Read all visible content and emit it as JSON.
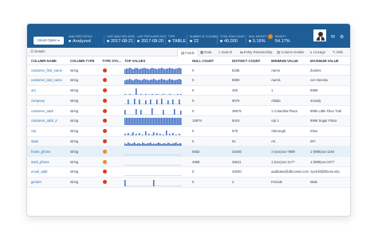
{
  "header": {
    "smart_option": "Smart Option ▾",
    "analyzed_status": {
      "label": "ANALYZED STATUS",
      "value": "Analyzed"
    },
    "last_analyzed_date": {
      "label": "LAST ANALYZED DATE",
      "value": "2017-08-21"
    },
    "last_populated_date": {
      "label": "LAST POPULATED DATE",
      "value": "2017-08-20"
    },
    "type": {
      "label": "TYPE",
      "value": "TABLE"
    },
    "number_of_columns": {
      "label": "NUMBER OF COLUMNS",
      "value": "22"
    },
    "total_row_count": {
      "label": "TOTAL ROW COUNT",
      "value": "40,000"
    },
    "null_density": {
      "label": "NULL DENSITY",
      "value": "5.16%"
    },
    "density": {
      "label": "DENSITY",
      "value": "54.17%"
    }
  },
  "tabs": {
    "details": "Details",
    "items": [
      "Fields",
      "Data",
      "Search",
      "Entity Relationship",
      "Column Details",
      "Lineage",
      "Wiki"
    ],
    "active": "Fields"
  },
  "columns": [
    "COLUMN NAME",
    "COLUMN TYPE",
    "TYPE STA...",
    "TOP VALUES",
    "NULL COUNT",
    "DISTINCT COUNT",
    "MINIMUM VALUE",
    "MAXIMUM VALUE"
  ],
  "rows": [
    {
      "name": "customer_first_name",
      "type": "string",
      "status": "#e03a1a",
      "null": "0",
      "distinct": "8335",
      "min": "Aaron",
      "max": "Zuisms",
      "spark": [
        6,
        7,
        7,
        8,
        7,
        6,
        7,
        8,
        7,
        6,
        7,
        7,
        8,
        7,
        7,
        6,
        7,
        8,
        7,
        7,
        6,
        7,
        7,
        8,
        7,
        6,
        7,
        7,
        8,
        7,
        7,
        6,
        7,
        7,
        8,
        7
      ]
    },
    {
      "name": "customer_last_name",
      "type": "string",
      "status": "#e03a1a",
      "null": "0",
      "distinct": "8809",
      "min": "Aamis",
      "max": "von Neesku",
      "spark": [
        5,
        6,
        6,
        7,
        6,
        5,
        6,
        7,
        6,
        6,
        5,
        6,
        7,
        6,
        6,
        5,
        6,
        6,
        7,
        6,
        5,
        6,
        6,
        7,
        6,
        6,
        5,
        6,
        7,
        6,
        6,
        5,
        6,
        6,
        7,
        6
      ]
    },
    {
      "name": "am",
      "type": "string",
      "status": "#e03a1a",
      "null": "0",
      "distinct": "400",
      "min": "1",
      "max": "9999",
      "spark": [
        1,
        0,
        0,
        1,
        0,
        0,
        0,
        8,
        0,
        0,
        1,
        0,
        0,
        1,
        0,
        0,
        0,
        1,
        0,
        0,
        1,
        0,
        0,
        0,
        1,
        0,
        0,
        0,
        1,
        0,
        0,
        0,
        0,
        1,
        0,
        1
      ]
    },
    {
      "name": "company",
      "type": "string",
      "status": "#e03a1a",
      "null": "0",
      "distinct": "9075",
      "min": "Abidia",
      "max": "Zooaily",
      "spark": [
        0,
        0,
        6,
        0,
        0,
        0,
        7,
        0,
        0,
        6,
        0,
        0,
        0,
        5,
        0,
        0,
        6,
        0,
        0,
        0,
        6,
        0,
        0,
        7,
        0,
        0,
        0,
        5,
        0,
        0,
        6,
        0,
        0,
        0,
        6,
        0
      ]
    },
    {
      "name": "customer_addr",
      "type": "string",
      "status": "#e03a1a",
      "null": "0",
      "distinct": "39575",
      "min": "1 Columbia Plaza",
      "max": "9995 Little Fleur Trail",
      "spark": [
        6,
        0,
        0,
        0,
        0,
        0,
        0,
        7,
        0,
        0,
        6,
        0,
        0,
        0,
        0,
        0,
        0,
        8,
        0,
        0,
        0,
        0,
        0,
        0,
        6,
        0,
        0,
        0,
        0,
        0,
        0,
        7,
        0,
        0,
        0,
        5
      ]
    },
    {
      "name": "customer_addr_2",
      "type": "string",
      "status": "#e03a1a",
      "null": "19579",
      "distinct": "9419",
      "min": "Apt 1",
      "max": "9998 Sugar Plaza",
      "spark": [
        9,
        9,
        9,
        9,
        9,
        9,
        9,
        9,
        9,
        9,
        9,
        9,
        9,
        9,
        9,
        9,
        9,
        9,
        9,
        9,
        9,
        9,
        9,
        9,
        9,
        9,
        9,
        9,
        9,
        9,
        9,
        9,
        9,
        9,
        9,
        9
      ]
    },
    {
      "name": "city",
      "type": "string",
      "status": "#e03a1a",
      "null": "0",
      "distinct": "979",
      "min": "Aberough",
      "max": "Inbur",
      "spark": [
        2,
        0,
        3,
        0,
        1,
        4,
        0,
        2,
        0,
        3,
        0,
        1,
        0,
        5,
        0,
        2,
        0,
        1,
        4,
        0,
        3,
        0,
        2,
        0,
        1,
        0,
        6,
        0,
        2,
        0,
        3,
        0,
        1,
        0,
        2,
        0
      ]
    },
    {
      "name": "state",
      "type": "string",
      "status": "#e03a1a",
      "null": "0",
      "distinct": "51",
      "min": "AK",
      "max": "WY",
      "spark": [
        3,
        2,
        4,
        3,
        2,
        3,
        4,
        2,
        3,
        3,
        2,
        4,
        3,
        2,
        3,
        3,
        4,
        2,
        3,
        2,
        3,
        4,
        3,
        2,
        3,
        3,
        2,
        4,
        3,
        2,
        3,
        3,
        4,
        2,
        3,
        3
      ]
    },
    {
      "name": "home_phone",
      "type": "string",
      "status": "#ee8a1e",
      "null": "5552",
      "distinct": "34446",
      "min": "1-(xxx)xxx-7889",
      "max": "1-(989)xxx-1194",
      "spark": [
        0,
        0,
        0,
        0,
        0,
        0,
        0,
        0,
        0,
        0,
        0,
        0,
        0,
        0,
        0,
        0,
        0,
        0,
        0,
        0,
        0,
        0,
        0,
        0,
        0,
        0,
        0,
        0,
        0,
        0,
        0,
        0,
        0,
        0,
        0,
        0
      ]
    },
    {
      "name": "work_phone",
      "type": "string",
      "status": "#ee8a1e",
      "null": "3088",
      "distinct": "36511",
      "min": "1-(xxx)xxx-1177",
      "max": "1-(989)xxx-2277",
      "spark": [
        0,
        0,
        0,
        0,
        0,
        0,
        0,
        0,
        0,
        0,
        0,
        0,
        0,
        0,
        0,
        0,
        0,
        0,
        0,
        0,
        0,
        0,
        0,
        0,
        0,
        0,
        0,
        0,
        0,
        0,
        0,
        0,
        0,
        0,
        0,
        0
      ]
    },
    {
      "name": "email_addr",
      "type": "string",
      "status": "#e03a1a",
      "null": "0",
      "distinct": "40000",
      "min": "aadbalee@dbcnews.com",
      "max": "zyvsrkt@illinois.edu",
      "spark": [
        0,
        0,
        0,
        0,
        0,
        0,
        0,
        0,
        0,
        0,
        0,
        0,
        0,
        0,
        0,
        0,
        0,
        0,
        0,
        0,
        0,
        0,
        0,
        0,
        0,
        0,
        0,
        0,
        0,
        0,
        0,
        0,
        0,
        0,
        0,
        0
      ]
    },
    {
      "name": "gender",
      "type": "string",
      "status": "#e03a1a",
      "null": "0",
      "distinct": "2",
      "min": "Female",
      "max": "Male",
      "spark": [
        8,
        0,
        0,
        0,
        0,
        0,
        0,
        0,
        0,
        0,
        0,
        0,
        0,
        0,
        0,
        0,
        0,
        0,
        8,
        0,
        0,
        0,
        0,
        0,
        0,
        0,
        0,
        0,
        0,
        0,
        0,
        0,
        0,
        0,
        0,
        0
      ]
    }
  ],
  "colors": {
    "brand": "#1e5d96",
    "link": "#2d6fb2",
    "bars": "#3f6fc6",
    "status_red": "#e03a1a",
    "status_orange": "#ee8a1e"
  }
}
